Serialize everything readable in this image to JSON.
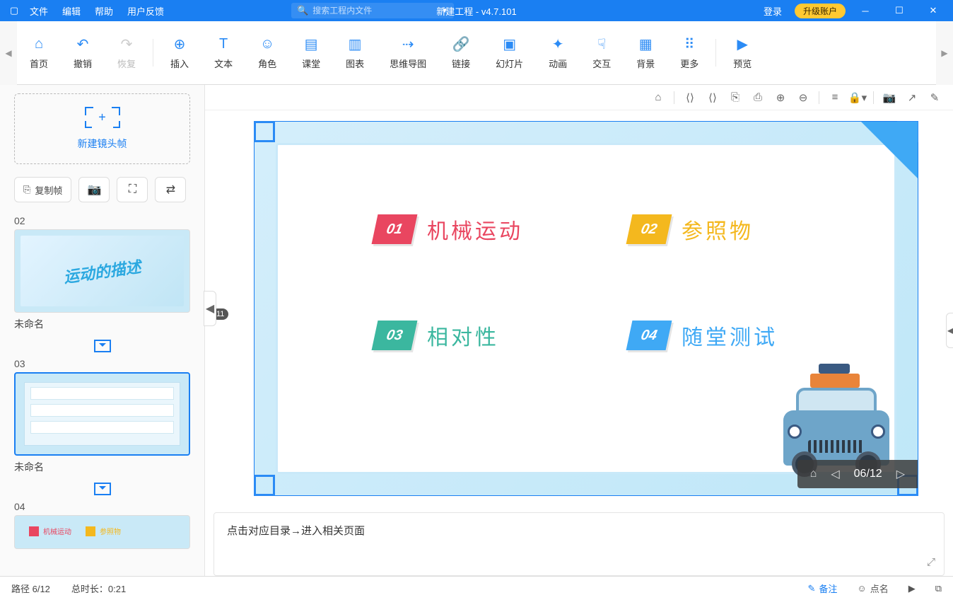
{
  "titlebar": {
    "menus": [
      "文件",
      "编辑",
      "帮助",
      "用户反馈"
    ],
    "title": "新建工程 - v4.7.101",
    "search_placeholder": "搜索工程内文件",
    "login": "登录",
    "upgrade": "升级账户"
  },
  "toolbar": {
    "home": "首页",
    "undo": "撤销",
    "redo": "恢复",
    "insert": "插入",
    "text": "文本",
    "role": "角色",
    "class": "课堂",
    "chart": "图表",
    "mindmap": "思维导图",
    "link": "链接",
    "slide": "幻灯片",
    "anim": "动画",
    "interact": "交互",
    "bg": "背景",
    "more": "更多",
    "preview": "预览"
  },
  "left": {
    "new_frame": "新建镜头帧",
    "copy_frame": "复制帧",
    "ruler_badge": "11",
    "frames": [
      {
        "num": "02",
        "title": "未命名"
      },
      {
        "num": "03",
        "title": "未命名"
      },
      {
        "num": "04",
        "title": ""
      }
    ],
    "thumb02_text": "运动的描述"
  },
  "slide": {
    "items": [
      {
        "num": "01",
        "text": "机械运动"
      },
      {
        "num": "02",
        "text": "参照物"
      },
      {
        "num": "03",
        "text": "相对性"
      },
      {
        "num": "04",
        "text": "随堂测试"
      }
    ],
    "overlay_counter": "06/12"
  },
  "notes": {
    "text": "点击对应目录→进入相关页面"
  },
  "status": {
    "path": "路径 6/12",
    "duration": "总时长：0:21",
    "remark": "备注",
    "rollcall": "点名"
  },
  "thumb04": {
    "a": "机械运动",
    "b": "参照物"
  }
}
